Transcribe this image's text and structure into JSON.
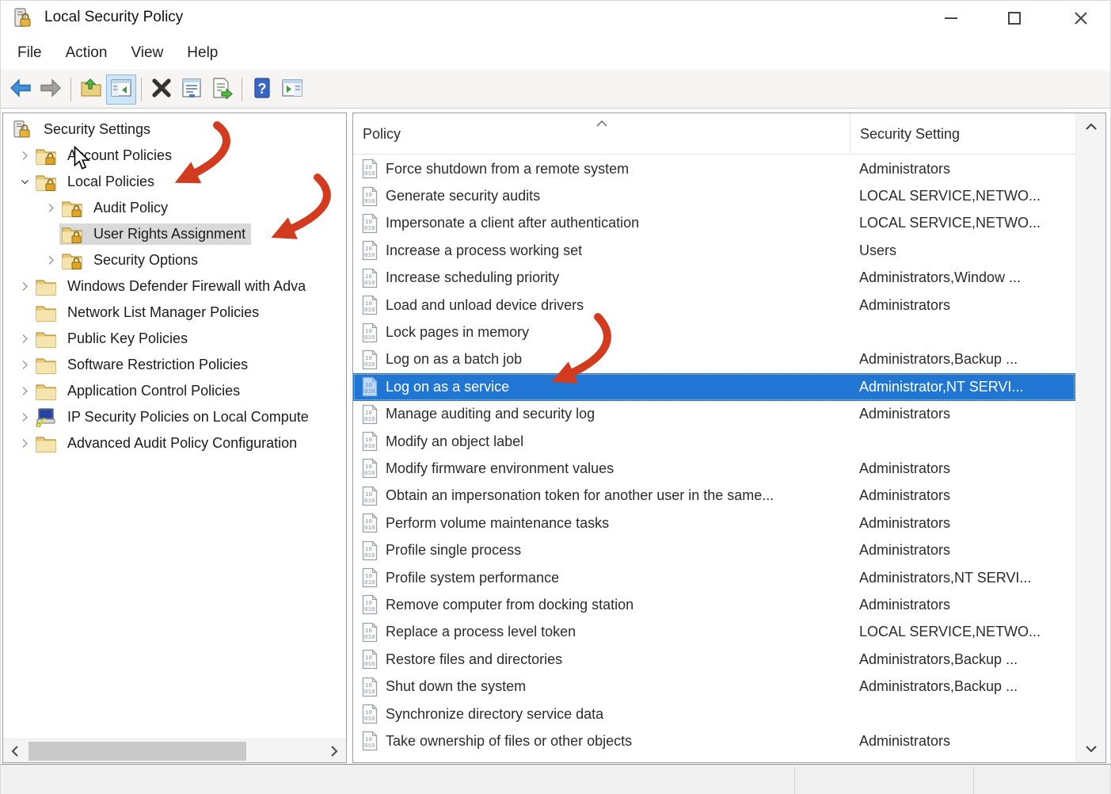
{
  "window": {
    "title": "Local Security Policy",
    "app_icon": "security-policy",
    "controls": [
      {
        "name": "minimize"
      },
      {
        "name": "maximize"
      },
      {
        "name": "close"
      }
    ]
  },
  "menu": {
    "items": [
      "File",
      "Action",
      "View",
      "Help"
    ]
  },
  "toolbar": {
    "buttons": [
      {
        "name": "back",
        "type": "button"
      },
      {
        "name": "forward",
        "type": "button"
      },
      {
        "type": "separator"
      },
      {
        "name": "up-one-level",
        "type": "button"
      },
      {
        "name": "show-hide-console-tree",
        "type": "button",
        "active": true
      },
      {
        "type": "separator"
      },
      {
        "name": "delete",
        "type": "button"
      },
      {
        "name": "properties",
        "type": "button"
      },
      {
        "name": "export-list",
        "type": "button"
      },
      {
        "type": "separator"
      },
      {
        "name": "help",
        "type": "button"
      },
      {
        "name": "show-hide-action-pane",
        "type": "button"
      }
    ]
  },
  "tree": {
    "items": [
      {
        "label": "Security Settings",
        "depth": 0,
        "expander": "none",
        "icon": "security-root",
        "selected": false
      },
      {
        "label": "Account Policies",
        "depth": 1,
        "expander": "collapsed",
        "icon": "folder-lock",
        "selected": false
      },
      {
        "label": "Local Policies",
        "depth": 1,
        "expander": "expanded",
        "icon": "folder-lock",
        "selected": false
      },
      {
        "label": "Audit Policy",
        "depth": 2,
        "expander": "collapsed",
        "icon": "folder-lock",
        "selected": false
      },
      {
        "label": "User Rights Assignment",
        "depth": 2,
        "expander": "none",
        "icon": "folder-lock",
        "selected": true
      },
      {
        "label": "Security Options",
        "depth": 2,
        "expander": "collapsed",
        "icon": "folder-lock",
        "selected": false
      },
      {
        "label": "Windows Defender Firewall with Adva",
        "depth": 1,
        "expander": "collapsed",
        "icon": "folder",
        "selected": false
      },
      {
        "label": "Network List Manager Policies",
        "depth": 1,
        "expander": "none",
        "icon": "folder",
        "selected": false
      },
      {
        "label": "Public Key Policies",
        "depth": 1,
        "expander": "collapsed",
        "icon": "folder",
        "selected": false
      },
      {
        "label": "Software Restriction Policies",
        "depth": 1,
        "expander": "collapsed",
        "icon": "folder",
        "selected": false
      },
      {
        "label": "Application Control Policies",
        "depth": 1,
        "expander": "collapsed",
        "icon": "folder",
        "selected": false
      },
      {
        "label": "IP Security Policies on Local Compute",
        "depth": 1,
        "expander": "collapsed",
        "icon": "ipsec-computer",
        "selected": false
      },
      {
        "label": "Advanced Audit Policy Configuration",
        "depth": 1,
        "expander": "collapsed",
        "icon": "folder",
        "selected": false
      }
    ]
  },
  "list": {
    "columns": [
      {
        "label": "Policy",
        "sorted": "asc"
      },
      {
        "label": "Security Setting",
        "sorted": null
      }
    ],
    "rows": [
      {
        "policy": "Force shutdown from a remote system",
        "setting": "Administrators",
        "selected": false
      },
      {
        "policy": "Generate security audits",
        "setting": "LOCAL SERVICE,NETWO...",
        "selected": false
      },
      {
        "policy": "Impersonate a client after authentication",
        "setting": "LOCAL SERVICE,NETWO...",
        "selected": false
      },
      {
        "policy": "Increase a process working set",
        "setting": "Users",
        "selected": false
      },
      {
        "policy": "Increase scheduling priority",
        "setting": "Administrators,Window ...",
        "selected": false
      },
      {
        "policy": "Load and unload device drivers",
        "setting": "Administrators",
        "selected": false
      },
      {
        "policy": "Lock pages in memory",
        "setting": "",
        "selected": false
      },
      {
        "policy": "Log on as a batch job",
        "setting": "Administrators,Backup ...",
        "selected": false
      },
      {
        "policy": "Log on as a service",
        "setting": "Administrator,NT SERVI...",
        "selected": true
      },
      {
        "policy": "Manage auditing and security log",
        "setting": "Administrators",
        "selected": false
      },
      {
        "policy": "Modify an object label",
        "setting": "",
        "selected": false
      },
      {
        "policy": "Modify firmware environment values",
        "setting": "Administrators",
        "selected": false
      },
      {
        "policy": "Obtain an impersonation token for another user in the same...",
        "setting": "Administrators",
        "selected": false
      },
      {
        "policy": "Perform volume maintenance tasks",
        "setting": "Administrators",
        "selected": false
      },
      {
        "policy": "Profile single process",
        "setting": "Administrators",
        "selected": false
      },
      {
        "policy": "Profile system performance",
        "setting": "Administrators,NT SERVI...",
        "selected": false
      },
      {
        "policy": "Remove computer from docking station",
        "setting": "Administrators",
        "selected": false
      },
      {
        "policy": "Replace a process level token",
        "setting": "LOCAL SERVICE,NETWO...",
        "selected": false
      },
      {
        "policy": "Restore files and directories",
        "setting": "Administrators,Backup ...",
        "selected": false
      },
      {
        "policy": "Shut down the system",
        "setting": "Administrators,Backup ...",
        "selected": false
      },
      {
        "policy": "Synchronize directory service data",
        "setting": "",
        "selected": false
      },
      {
        "policy": "Take ownership of files or other objects",
        "setting": "Administrators",
        "selected": false
      }
    ]
  },
  "annotations": {
    "arrow_color": "#d23b1d",
    "arrows": [
      {
        "name": "arrow-to-local-policies",
        "target": "Local Policies"
      },
      {
        "name": "arrow-to-user-rights-assignment",
        "target": "User Rights Assignment"
      },
      {
        "name": "arrow-to-log-on-as-a-service",
        "target": "Log on as a service"
      }
    ]
  },
  "colors": {
    "selection_blue": "#2176d4",
    "tree_inactive_selection": "#d9d9d9",
    "folder_yellow": "#f2dc9b"
  }
}
